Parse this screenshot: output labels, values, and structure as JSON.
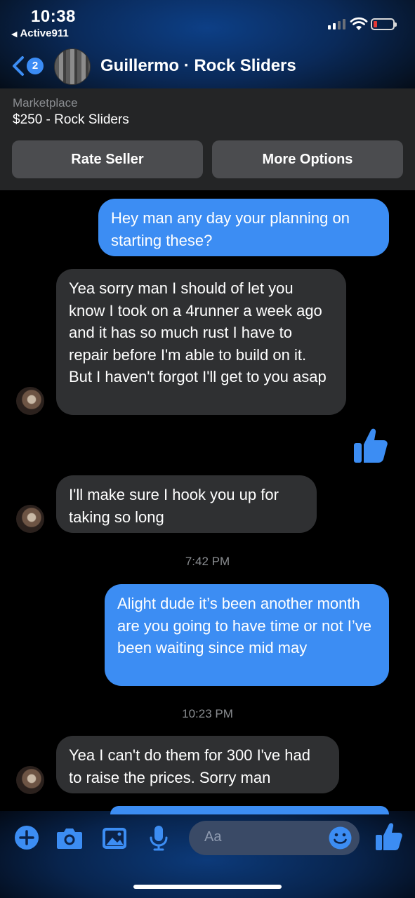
{
  "status_bar": {
    "time": "10:38",
    "back_app": "Active911"
  },
  "header": {
    "unread_badge": "2",
    "title": "Guillermo · Rock Sliders"
  },
  "marketplace": {
    "label": "Marketplace",
    "item": "$250 - Rock Sliders",
    "rate_button": "Rate Seller",
    "more_button": "More Options"
  },
  "messages": [
    {
      "from": "me",
      "text": "Hey man any day your planning on starting these?"
    },
    {
      "from": "them",
      "text": "Yea sorry man I should of let you know I took on a 4runner a week ago and it has so much rust I have to repair before I'm able to build on it. But I haven't forgot I'll get to you asap"
    },
    {
      "from": "me",
      "reaction": "thumbs-up-icon"
    },
    {
      "from": "them",
      "text": "I'll make sure I hook you up for taking so long"
    },
    {
      "timestamp": "7:42 PM"
    },
    {
      "from": "me",
      "text": "Alight dude it’s been another month are you going to have time or not I’ve been waiting since mid may"
    },
    {
      "timestamp": "10:23 PM"
    },
    {
      "from": "them",
      "text": "Yea I can't do them for 300 I've had to raise the prices. Sorry man"
    }
  ],
  "composer": {
    "placeholder": "Aa",
    "icons": [
      "plus-icon",
      "camera-icon",
      "photo-icon",
      "microphone-icon",
      "emoji-icon",
      "thumbs-up-icon"
    ]
  },
  "colors": {
    "accent": "#3c8df3",
    "incoming_bubble": "#2f3032",
    "panel": "#242526",
    "button": "#4b4c4f"
  }
}
